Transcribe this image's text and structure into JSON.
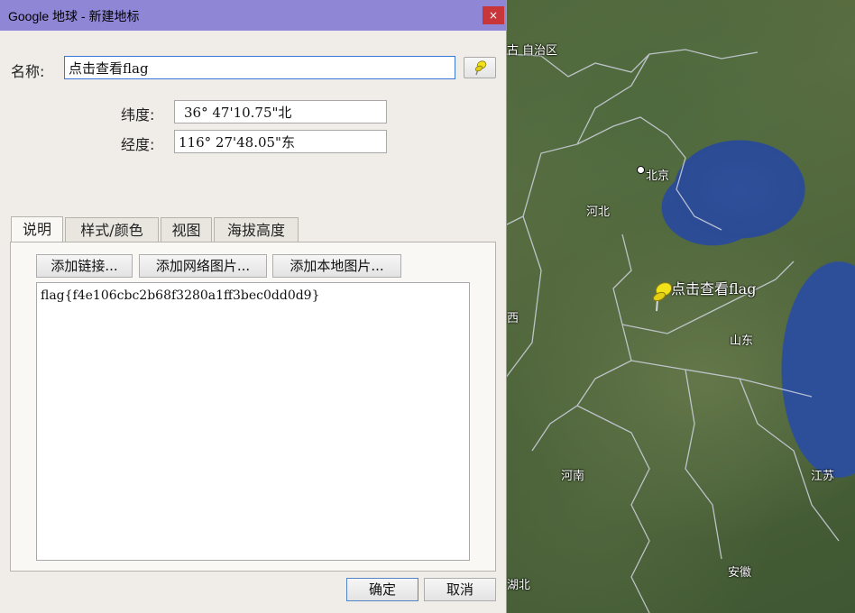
{
  "window": {
    "title": "Google 地球 - 新建地标",
    "close_glyph": "×"
  },
  "form": {
    "name_label": "名称:",
    "name_value": "点击查看flag",
    "lat_label": "纬度:",
    "lat_value": "36° 47'10.75\"北",
    "lon_label": "经度:",
    "lon_value": "116° 27'48.05\"东"
  },
  "tabs": [
    {
      "label": "说明"
    },
    {
      "label": "样式/颜色"
    },
    {
      "label": "视图"
    },
    {
      "label": "海拔高度"
    }
  ],
  "description_buttons": {
    "add_link": "添加链接...",
    "add_web_image": "添加网络图片...",
    "add_local_image": "添加本地图片..."
  },
  "description_text": "flag{f4e106cbc2b68f3280a1ff3bec0dd0d9}",
  "footer": {
    "ok": "确定",
    "cancel": "取消"
  },
  "map": {
    "labels": {
      "neimenggu": "古 自治区",
      "beijing": "北京",
      "hebei": "河北",
      "shandong": "山东",
      "henan": "河南",
      "jiangsu": "江苏",
      "anhui": "安徽",
      "shanxi_partial": "西",
      "hubei_partial": "湖北"
    },
    "placemark_label": "点击查看flag",
    "pin_color": "#f2e21a"
  }
}
